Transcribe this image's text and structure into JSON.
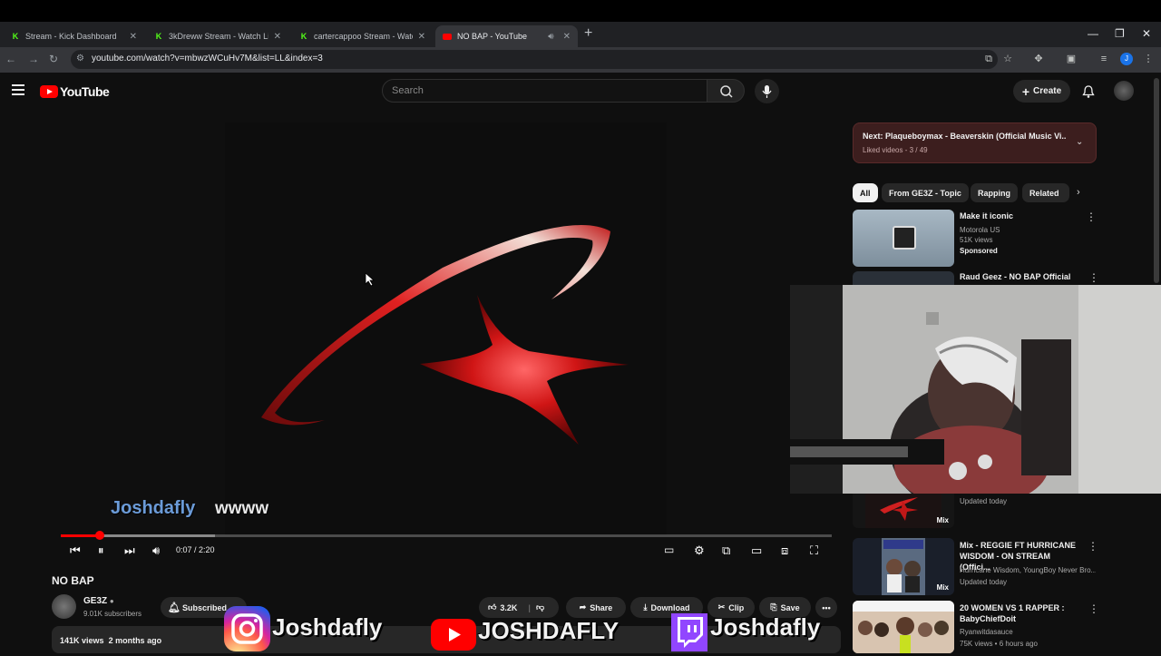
{
  "browser": {
    "tabs": [
      {
        "title": "Stream - Kick Dashboard",
        "favicon": "kick-icon"
      },
      {
        "title": "3kDreww Stream - Watch Live o",
        "favicon": "kick-icon"
      },
      {
        "title": "cartercappoo Stream - Watch L",
        "favicon": "kick-icon"
      },
      {
        "title": "NO BAP - YouTube",
        "favicon": "youtube-icon",
        "active": true
      }
    ],
    "url": "youtube.com/watch?v=mbwzWCuHv7M&list=LL&index=3",
    "profile_initial": "J"
  },
  "youtube": {
    "logo_text": "YouTube",
    "search_placeholder": "Search",
    "create_label": "Create"
  },
  "player": {
    "time": "0:07 / 2:20",
    "progress_fraction": 0.05,
    "chat_overlay": {
      "name": "Joshdafly",
      "message": "wwww"
    }
  },
  "video": {
    "title": "NO BAP",
    "channel": "GE3Z",
    "subscribers": "9.01K subscribers",
    "subscribe_label": "Subscribed",
    "likes": "3.2K",
    "share_label": "Share",
    "download_label": "Download",
    "clip_label": "Clip",
    "save_label": "Save",
    "views": "141K views",
    "age": "2 months ago"
  },
  "sidebar": {
    "playlist_next": "Next: Plaqueboymax - Beaverskin (Official Music Vi...",
    "playlist_sub": "Liked videos - 3 / 49",
    "chips": [
      "All",
      "From GE3Z - Topic",
      "Rapping",
      "Related"
    ],
    "items": [
      {
        "title": "Make it iconic",
        "meta1": "Motorola US",
        "meta2": "51K views",
        "meta3": "Sponsored"
      },
      {
        "title": "Raud Geez - NO BAP Official"
      },
      {
        "meta1": "Updated today",
        "badge": "Mix"
      },
      {
        "title": "Mix - REGGIE FT HURRICANE WISDOM - ON STREAM (Offici...",
        "meta1": "Hurricane Wisdom, YoungBoy Never Bro...",
        "meta2": "Updated today",
        "badge": "Mix"
      },
      {
        "title": "20 WOMEN VS 1 RAPPER : BabyChiefDoit",
        "meta1": "Ryanwitdasauce",
        "meta2": "75K views • 6 hours ago"
      }
    ]
  },
  "socials": {
    "instagram": "Joshdafly",
    "youtube": "JOSHDAFLY",
    "twitch": "Joshdafly"
  },
  "colors": {
    "accent_red": "#ff0000",
    "chat_name": "#6b9bd8",
    "kick_green": "#53fc18"
  }
}
